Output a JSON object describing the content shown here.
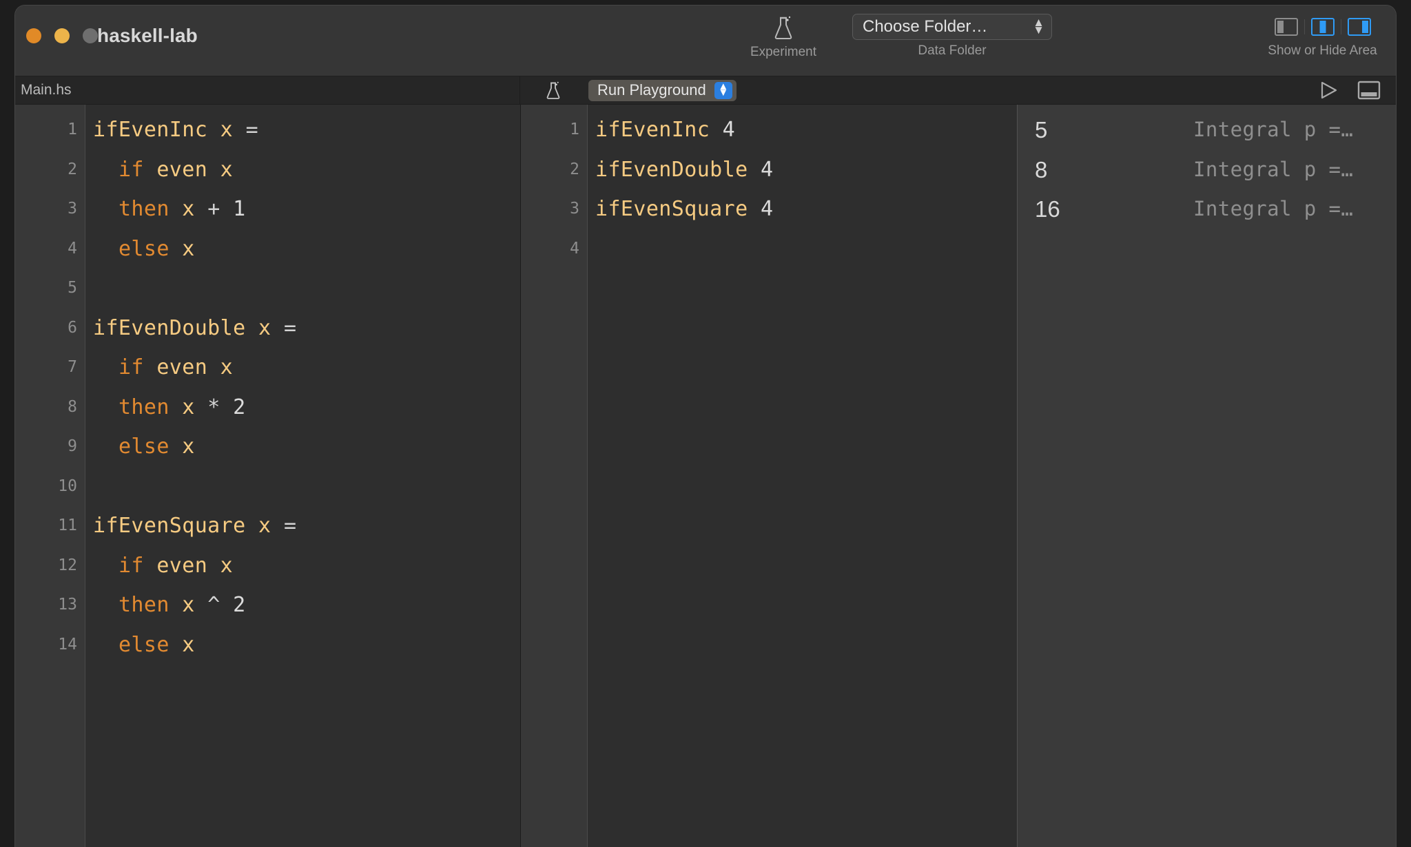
{
  "window": {
    "title": "haskell-lab",
    "traffic_lights": [
      "close",
      "minimize",
      "zoom"
    ]
  },
  "toolbar": {
    "experiment": {
      "icon": "flask-icon",
      "caption": "Experiment"
    },
    "data_folder": {
      "caption": "Data Folder",
      "popup_value": "Choose Folder…"
    },
    "show_hide": {
      "caption": "Show or Hide Area",
      "toggles": [
        {
          "name": "left-panel-toggle",
          "active": false
        },
        {
          "name": "center-panel-toggle",
          "active": true
        },
        {
          "name": "right-panel-toggle",
          "active": true
        }
      ]
    }
  },
  "subtoolbar": {
    "file_tab": "Main.hs",
    "flask_icon": "flask-icon",
    "run_popup": "Run Playground",
    "run_icon": "play-triangle-icon",
    "console_icon": "console-panel-icon"
  },
  "editor": {
    "filename": "Main.hs",
    "line_numbers": [
      "1",
      "2",
      "3",
      "4",
      "5",
      "6",
      "7",
      "8",
      "9",
      "10",
      "11",
      "12",
      "13",
      "14"
    ],
    "lines": [
      [
        {
          "t": "ifEvenInc",
          "c": "fn"
        },
        {
          "t": " ",
          "c": "op"
        },
        {
          "t": "x",
          "c": "var"
        },
        {
          "t": " ",
          "c": "op"
        },
        {
          "t": "=",
          "c": "op"
        }
      ],
      [
        {
          "t": "  ",
          "c": "op"
        },
        {
          "t": "if",
          "c": "kw"
        },
        {
          "t": " ",
          "c": "op"
        },
        {
          "t": "even",
          "c": "var"
        },
        {
          "t": " ",
          "c": "op"
        },
        {
          "t": "x",
          "c": "var"
        }
      ],
      [
        {
          "t": "  ",
          "c": "op"
        },
        {
          "t": "then",
          "c": "kw"
        },
        {
          "t": " ",
          "c": "op"
        },
        {
          "t": "x",
          "c": "var"
        },
        {
          "t": " ",
          "c": "op"
        },
        {
          "t": "+",
          "c": "op"
        },
        {
          "t": " ",
          "c": "op"
        },
        {
          "t": "1",
          "c": "num"
        }
      ],
      [
        {
          "t": "  ",
          "c": "op"
        },
        {
          "t": "else",
          "c": "kw"
        },
        {
          "t": " ",
          "c": "op"
        },
        {
          "t": "x",
          "c": "var"
        }
      ],
      [],
      [
        {
          "t": "ifEvenDouble",
          "c": "fn"
        },
        {
          "t": " ",
          "c": "op"
        },
        {
          "t": "x",
          "c": "var"
        },
        {
          "t": " ",
          "c": "op"
        },
        {
          "t": "=",
          "c": "op"
        }
      ],
      [
        {
          "t": "  ",
          "c": "op"
        },
        {
          "t": "if",
          "c": "kw"
        },
        {
          "t": " ",
          "c": "op"
        },
        {
          "t": "even",
          "c": "var"
        },
        {
          "t": " ",
          "c": "op"
        },
        {
          "t": "x",
          "c": "var"
        }
      ],
      [
        {
          "t": "  ",
          "c": "op"
        },
        {
          "t": "then",
          "c": "kw"
        },
        {
          "t": " ",
          "c": "op"
        },
        {
          "t": "x",
          "c": "var"
        },
        {
          "t": " ",
          "c": "op"
        },
        {
          "t": "*",
          "c": "op"
        },
        {
          "t": " ",
          "c": "op"
        },
        {
          "t": "2",
          "c": "num"
        }
      ],
      [
        {
          "t": "  ",
          "c": "op"
        },
        {
          "t": "else",
          "c": "kw"
        },
        {
          "t": " ",
          "c": "op"
        },
        {
          "t": "x",
          "c": "var"
        }
      ],
      [],
      [
        {
          "t": "ifEvenSquare",
          "c": "fn"
        },
        {
          "t": " ",
          "c": "op"
        },
        {
          "t": "x",
          "c": "var"
        },
        {
          "t": " ",
          "c": "op"
        },
        {
          "t": "=",
          "c": "op"
        }
      ],
      [
        {
          "t": "  ",
          "c": "op"
        },
        {
          "t": "if",
          "c": "kw"
        },
        {
          "t": " ",
          "c": "op"
        },
        {
          "t": "even",
          "c": "var"
        },
        {
          "t": " ",
          "c": "op"
        },
        {
          "t": "x",
          "c": "var"
        }
      ],
      [
        {
          "t": "  ",
          "c": "op"
        },
        {
          "t": "then",
          "c": "kw"
        },
        {
          "t": " ",
          "c": "op"
        },
        {
          "t": "x",
          "c": "var"
        },
        {
          "t": " ",
          "c": "op"
        },
        {
          "t": "^",
          "c": "op"
        },
        {
          "t": " ",
          "c": "op"
        },
        {
          "t": "2",
          "c": "num"
        }
      ],
      [
        {
          "t": "  ",
          "c": "op"
        },
        {
          "t": "else",
          "c": "kw"
        },
        {
          "t": " ",
          "c": "op"
        },
        {
          "t": "x",
          "c": "var"
        }
      ]
    ]
  },
  "playground": {
    "line_numbers": [
      "1",
      "2",
      "3",
      "4"
    ],
    "lines": [
      [
        {
          "t": "ifEvenInc",
          "c": "fn"
        },
        {
          "t": " ",
          "c": "op"
        },
        {
          "t": "4",
          "c": "num"
        }
      ],
      [
        {
          "t": "ifEvenDouble",
          "c": "fn"
        },
        {
          "t": " ",
          "c": "op"
        },
        {
          "t": "4",
          "c": "num"
        }
      ],
      [
        {
          "t": "ifEvenSquare",
          "c": "fn"
        },
        {
          "t": " ",
          "c": "op"
        },
        {
          "t": "4",
          "c": "num"
        }
      ],
      []
    ]
  },
  "results": {
    "rows": [
      {
        "value": "5",
        "type": "Integral p =…"
      },
      {
        "value": "8",
        "type": "Integral p =…"
      },
      {
        "value": "16",
        "type": "Integral p =…"
      }
    ]
  },
  "colors": {
    "accent_blue": "#2f9bf5",
    "keyword": "#e28a31",
    "identifier": "#f6cb82",
    "operator": "#d3d3d3",
    "editor_bg": "#2e2e2e",
    "gutter_bg": "#383838",
    "result_bg": "#3a3a3a"
  }
}
